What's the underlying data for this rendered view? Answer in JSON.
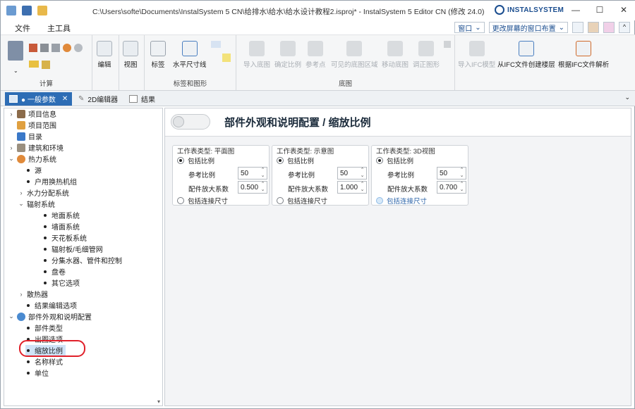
{
  "window": {
    "title": "C:\\Users\\softe\\Documents\\InstalSystem 5 CN\\给排水\\给水\\给水设计教程2.isproj* - InstalSystem 5 Editor CN (修改 24.0)",
    "brand": "INSTALSYSTEM",
    "min": "—",
    "max": "☐",
    "close": "✕"
  },
  "menu": {
    "file": "文件",
    "main_tools": "主工具",
    "window_dd": "窗口",
    "layout_dd": "更改屏幕的窗口布置"
  },
  "ribbon": {
    "group_calc": "计算",
    "btn_edit": "编辑",
    "btn_view": "视图",
    "btn_label": "标签",
    "btn_hdim": "水平尺寸线",
    "group_labels": "标签和图形",
    "btn_import_base": "导入底图",
    "btn_set_scale": "确定比例",
    "btn_ref_point": "参考点",
    "btn_visible_area": "可见的底图区域",
    "btn_move_base": "移动底图",
    "btn_adjust": "调正图形",
    "btn_import_ifc": "导入IFC模型",
    "btn_ifc_floors": "从IFC文件创建楼层",
    "btn_ifc_parse": "根据IFC文件解析",
    "group_base": "底图"
  },
  "tabs": [
    {
      "label": "● 一般参数"
    },
    {
      "label": "2D编辑器"
    },
    {
      "label": "结果"
    }
  ],
  "tree": [
    {
      "label": "项目信息"
    },
    {
      "label": "项目范围"
    },
    {
      "label": "目录"
    },
    {
      "label": "建筑和环境"
    },
    {
      "label": "热力系统"
    },
    {
      "label": "源"
    },
    {
      "label": "户用换热机组"
    },
    {
      "label": "水力分配系统"
    },
    {
      "label": "辐射系统"
    },
    {
      "label": "地面系统"
    },
    {
      "label": "墙面系统"
    },
    {
      "label": "天花板系统"
    },
    {
      "label": "辐射板/毛细管网"
    },
    {
      "label": "分集水器、管件和控制"
    },
    {
      "label": "盘卷"
    },
    {
      "label": "其它选项"
    },
    {
      "label": "散热器"
    },
    {
      "label": "结果编辑选项"
    },
    {
      "label": "部件外观和说明配置"
    },
    {
      "label": "部件类型"
    },
    {
      "label": "出图选项"
    },
    {
      "label": "缩放比例"
    },
    {
      "label": "名称样式"
    },
    {
      "label": "单位"
    }
  ],
  "page": {
    "back_label": "",
    "title": "部件外观和说明配置 / 缩放比例"
  },
  "panels": [
    {
      "title": "工作表类型: 平面图",
      "include_scale": "包括比例",
      "ref_scale_label": "参考比例",
      "ref_scale": "50",
      "factor_label": "配件放大系数",
      "factor": "0.500",
      "include_dims": "包括连接尺寸"
    },
    {
      "title": "工作表类型: 示意图",
      "include_scale": "包括比例",
      "ref_scale_label": "参考比例",
      "ref_scale": "50",
      "factor_label": "配件放大系数",
      "factor": "1.000",
      "include_dims": "包括连接尺寸"
    },
    {
      "title": "工作表类型: 3D视图",
      "include_scale": "包括比例",
      "ref_scale_label": "参考比例",
      "ref_scale": "50",
      "factor_label": "配件放大系数",
      "factor": "0.700",
      "include_dims": "包括连接尺寸"
    }
  ],
  "colors": {
    "accent": "#2d6db5",
    "selection": "#cfe3f7",
    "annotation_circle": "#e0202a"
  }
}
